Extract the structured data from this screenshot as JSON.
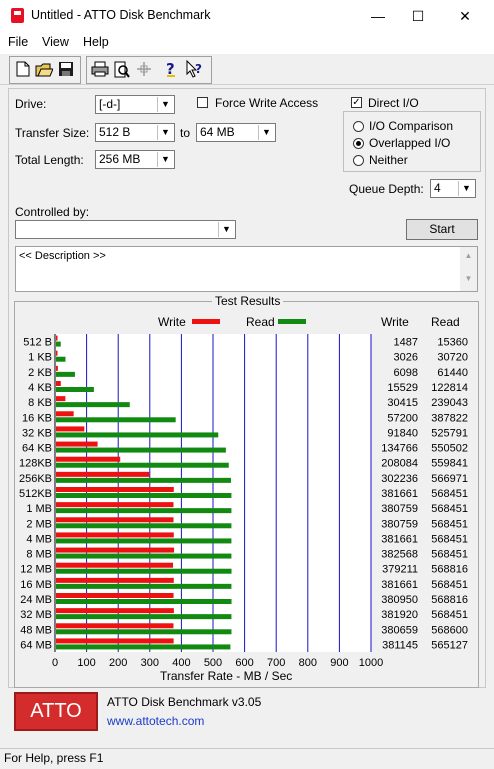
{
  "window": {
    "title": "Untitled - ATTO Disk Benchmark"
  },
  "menu": [
    "File",
    "View",
    "Help"
  ],
  "toolbar": {
    "icons": [
      "new-icon",
      "open-icon",
      "save-icon",
      "print-icon",
      "print-preview-icon",
      "move-icon",
      "help-icon",
      "context-help-icon"
    ]
  },
  "form": {
    "drive_label": "Drive:",
    "drive_value": "[-d-]",
    "force_write_label": "Force Write Access",
    "direct_io_label": "Direct I/O",
    "direct_io_checked": true,
    "transfer_size_label": "Transfer Size:",
    "transfer_from": "512 B",
    "to_label": "to",
    "transfer_to": "64 MB",
    "total_length_label": "Total Length:",
    "total_length": "256 MB",
    "io_options": [
      "I/O Comparison",
      "Overlapped I/O",
      "Neither"
    ],
    "io_selected": 1,
    "queue_depth_label": "Queue Depth:",
    "queue_depth": "4",
    "controlled_by_label": "Controlled by:",
    "controlled_by_value": "",
    "start_label": "Start",
    "description": "<< Description >>"
  },
  "results": {
    "title": "Test Results",
    "legend_write": "Write",
    "legend_read": "Read",
    "col_write": "Write",
    "col_read": "Read",
    "xlabel": "Transfer Rate - MB / Sec",
    "colors": {
      "write": "#ee1111",
      "read": "#128a12",
      "grid": "#1515c8"
    }
  },
  "chart_data": {
    "type": "bar",
    "categories": [
      "512 B",
      "1 KB",
      "2 KB",
      "4 KB",
      "8 KB",
      "16 KB",
      "32 KB",
      "64 KB",
      "128KB",
      "256KB",
      "512KB",
      "1 MB",
      "2 MB",
      "4 MB",
      "8 MB",
      "12 MB",
      "16 MB",
      "24 MB",
      "32 MB",
      "48 MB",
      "64 MB"
    ],
    "series": [
      {
        "name": "Write",
        "values": [
          1487,
          3026,
          6098,
          15529,
          30415,
          57200,
          91840,
          134766,
          208084,
          302236,
          381661,
          380759,
          380759,
          381661,
          382568,
          379211,
          381661,
          380950,
          381920,
          380659,
          381145
        ]
      },
      {
        "name": "Read",
        "values": [
          15360,
          30720,
          61440,
          122814,
          239043,
          387822,
          525791,
          550502,
          559841,
          566971,
          568451,
          568451,
          568451,
          568451,
          568451,
          568816,
          568451,
          568816,
          568451,
          568600,
          565127
        ]
      }
    ],
    "xlabel": "Transfer Rate - MB / Sec",
    "xticks": [
      "0",
      "100",
      "200",
      "300",
      "400",
      "500",
      "600",
      "700",
      "800",
      "900",
      "1000"
    ],
    "xlim": [
      0,
      1000
    ],
    "value_units": "KB/s",
    "grid": true,
    "legend": "top"
  },
  "footer": {
    "logo_text": "ATTO",
    "app_name": "ATTO Disk Benchmark v3.05",
    "url": "www.attotech.com"
  },
  "status": "For Help, press F1"
}
